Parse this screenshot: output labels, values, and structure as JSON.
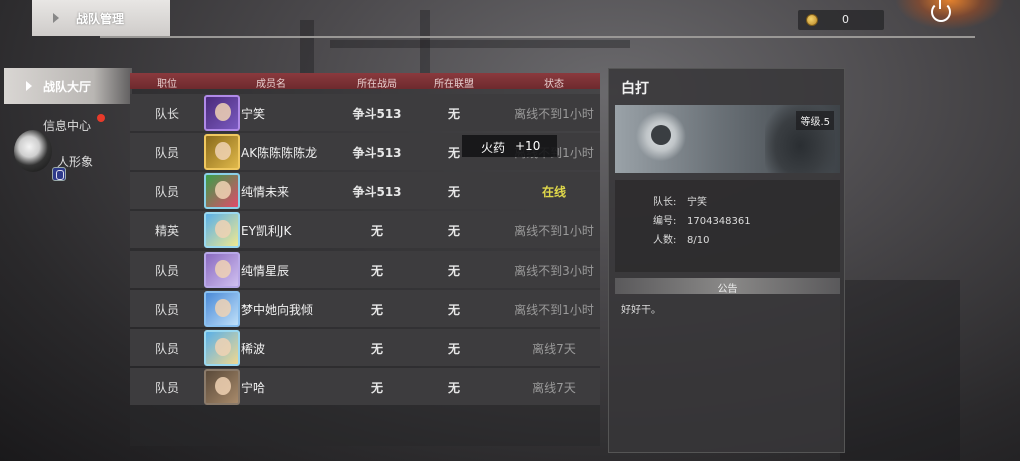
{
  "header": {
    "tab_title": "战队管理",
    "currency": {
      "icon": "coin-icon",
      "value": "0"
    },
    "power_icon": "power-icon"
  },
  "sidebar": {
    "items": [
      {
        "label": "战队大厅",
        "active": true
      },
      {
        "label": "信息中心",
        "has_notification": true
      },
      {
        "label": "人形象"
      }
    ]
  },
  "members_table": {
    "columns": [
      "职位",
      "成员名",
      "所在战局",
      "所在联盟",
      "状态"
    ],
    "rows": [
      {
        "role": "队长",
        "name": "宁笑",
        "battle": "争斗513",
        "alliance": "无",
        "status": "离线不到1小时",
        "online": false
      },
      {
        "role": "队员",
        "name": "AK陈陈陈陈龙",
        "battle": "争斗513",
        "alliance": "无",
        "status": "离线不到1小时",
        "online": false
      },
      {
        "role": "队员",
        "name": "纯情未来",
        "battle": "争斗513",
        "alliance": "无",
        "status": "在线",
        "online": true
      },
      {
        "role": "精英",
        "name": "EY凯利JK",
        "battle": "无",
        "alliance": "无",
        "status": "离线不到1小时",
        "online": false
      },
      {
        "role": "队员",
        "name": "纯情星辰",
        "battle": "无",
        "alliance": "无",
        "status": "离线不到3小时",
        "online": false
      },
      {
        "role": "队员",
        "name": "梦中她向我倾",
        "battle": "无",
        "alliance": "无",
        "status": "离线不到1小时",
        "online": false
      },
      {
        "role": "队员",
        "name": "稀波",
        "battle": "无",
        "alliance": "无",
        "status": "离线7天",
        "online": false
      },
      {
        "role": "队员",
        "name": "宁哈",
        "battle": "无",
        "alliance": "无",
        "status": "离线7天",
        "online": false
      }
    ]
  },
  "tooltip": {
    "item": "火药",
    "value": "+10"
  },
  "team_panel": {
    "team_name": "白打",
    "level": "等级.5",
    "captain_label": "队长:",
    "captain": "宁笑",
    "id_label": "编号:",
    "id": "1704348361",
    "count_label": "人数:",
    "count": "8/10",
    "notice_title": "公告",
    "notice_text": "好好干。"
  }
}
